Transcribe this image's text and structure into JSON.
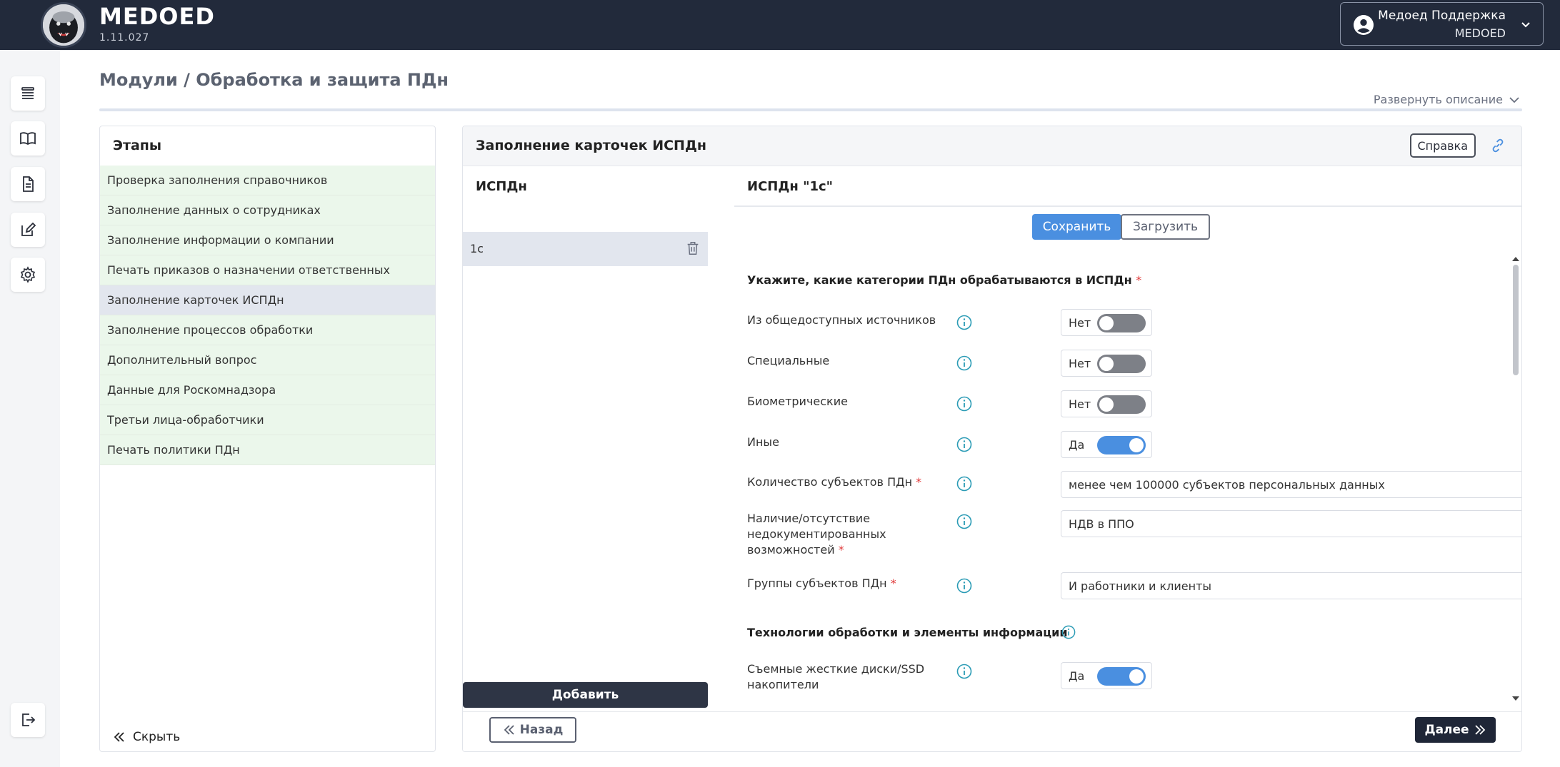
{
  "header": {
    "brand": "MEDOED",
    "version": "1.11.027",
    "user_name": "Медоед Поддержка",
    "user_org": "MEDOED"
  },
  "sidebar": {
    "icons": [
      "list-icon",
      "book-icon",
      "document-icon",
      "edit-icon",
      "gear-icon",
      "logout-icon"
    ]
  },
  "page": {
    "title": "Модули / Обработка и защита ПДн",
    "expand_description": "Развернуть описание"
  },
  "stages": {
    "title": "Этапы",
    "items": [
      {
        "label": "Проверка заполнения справочников",
        "state": "done"
      },
      {
        "label": "Заполнение данных о сотрудниках",
        "state": "done"
      },
      {
        "label": "Заполнение информации о компании",
        "state": "done"
      },
      {
        "label": "Печать приказов о назначении ответственных",
        "state": "done"
      },
      {
        "label": "Заполнение карточек ИСПДн",
        "state": "active"
      },
      {
        "label": "Заполнение процессов обработки",
        "state": "done"
      },
      {
        "label": "Дополнительный вопрос",
        "state": "done"
      },
      {
        "label": "Данные для Роскомнадзора",
        "state": "done"
      },
      {
        "label": "Третьи лица-обработчики",
        "state": "done"
      },
      {
        "label": "Печать политики ПДн",
        "state": "done"
      }
    ],
    "hide_label": "Скрыть"
  },
  "panel": {
    "title": "Заполнение карточек ИСПДн",
    "help_label": "Справка",
    "ispdn_header": "ИСПДн",
    "ispdn_items": [
      "1с"
    ],
    "add_label": "Добавить",
    "form_header": "ИСПДн \"1с\"",
    "save_label": "Сохранить",
    "load_label": "Загрузить",
    "section1_title": "Укажите, какие категории ПДн обрабатываются в ИСПДн",
    "required_mark": "*",
    "toggles": [
      {
        "label": "Из общедоступных источников",
        "value": "Нет",
        "on": false
      },
      {
        "label": "Специальные",
        "value": "Нет",
        "on": false
      },
      {
        "label": "Биометрические",
        "value": "Нет",
        "on": false
      },
      {
        "label": "Иные",
        "value": "Да",
        "on": true
      }
    ],
    "selects": [
      {
        "label": "Количество субъектов ПДн",
        "value": "менее чем 100000 субъектов персональных данных"
      },
      {
        "label": "Наличие/отсутствие недокументированных возможностей",
        "label_line1": "Наличие/отсутствие",
        "label_line2": "недокументированных",
        "label_line3": "возможностей",
        "value": "НДВ в ППО"
      },
      {
        "label": "Группы субъектов ПДн",
        "value": "И работники и клиенты"
      }
    ],
    "section2_title": "Технологии обработки и элементы информации",
    "tech_toggles": [
      {
        "label_line1": "Съемные жесткие диски/SSD",
        "label_line2": "накопители",
        "value": "Да",
        "on": true
      }
    ],
    "back_label": "Назад",
    "next_label": "Далее"
  },
  "colors": {
    "header_bg": "#222a3b",
    "accent": "#4a8fe0",
    "stage_done_bg": "#ebf7eb",
    "stage_active_bg": "#e2e6ee",
    "info_icon": "#2a9bb5",
    "required": "#e03838"
  }
}
